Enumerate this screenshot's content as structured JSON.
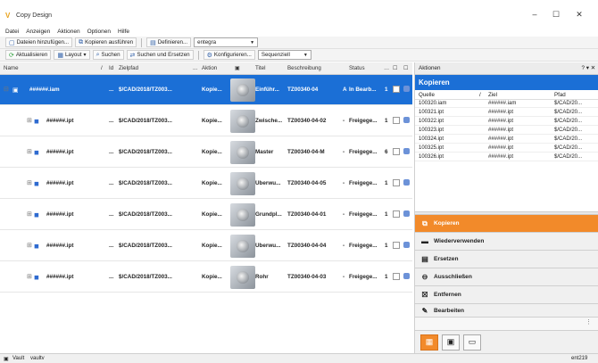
{
  "window": {
    "title": "Copy Design",
    "app_icon": "V"
  },
  "menu": [
    "Datei",
    "Anzeigen",
    "Aktionen",
    "Optionen",
    "Hilfe"
  ],
  "toolbar1": {
    "add_files": "Dateien hinzufügen...",
    "run_copy": "Kopieren ausführen",
    "define": "Definieren...",
    "combo_value": "entegra"
  },
  "toolbar2": {
    "refresh": "Aktualisieren",
    "layout": "Layout",
    "search": "Suchen",
    "search_replace": "Suchen und Ersetzen",
    "configure": "Konfigurieren...",
    "mode": "Sequenziell"
  },
  "grid": {
    "headers": {
      "name": "Name",
      "slash": "/",
      "id": "Id",
      "target": "Zielpfad",
      "ellipsis": "...",
      "action": "Aktion",
      "title": "Titel",
      "desc": "Beschreibung",
      "status": "Status"
    },
    "rows": [
      {
        "name": "######.iam",
        "dots": "...",
        "path": "$/CAD/2018/TZ003...",
        "action": "Kopie...",
        "title": "Einführ...",
        "desc": "TZ00340-04",
        "flag": "A",
        "status": "In Bearb...",
        "count": "1",
        "selected": true
      },
      {
        "name": "######.ipt",
        "dots": "...",
        "path": "$/CAD/2018/TZ003...",
        "action": "Kopie...",
        "title": "Zwische...",
        "desc": "TZ00340-04-02",
        "flag": "-",
        "status": "Freigege...",
        "count": "1"
      },
      {
        "name": "######.ipt",
        "dots": "...",
        "path": "$/CAD/2018/TZ003...",
        "action": "Kopie...",
        "title": "Master",
        "desc": "TZ00340-04-M",
        "flag": "-",
        "status": "Freigege...",
        "count": "6"
      },
      {
        "name": "######.ipt",
        "dots": "...",
        "path": "$/CAD/2018/TZ003...",
        "action": "Kopie...",
        "title": "Überwu...",
        "desc": "TZ00340-04-05",
        "flag": "-",
        "status": "Freigege...",
        "count": "1"
      },
      {
        "name": "######.ipt",
        "dots": "...",
        "path": "$/CAD/2018/TZ003...",
        "action": "Kopie...",
        "title": "Grundpl...",
        "desc": "TZ00340-04-01",
        "flag": "-",
        "status": "Freigege...",
        "count": "1"
      },
      {
        "name": "######.ipt",
        "dots": "...",
        "path": "$/CAD/2018/TZ003...",
        "action": "Kopie...",
        "title": "Überwu...",
        "desc": "TZ00340-04-04",
        "flag": "-",
        "status": "Freigege...",
        "count": "1"
      },
      {
        "name": "######.ipt",
        "dots": "...",
        "path": "$/CAD/2018/TZ003...",
        "action": "Kopie...",
        "title": "Rohr",
        "desc": "TZ00340-04-03",
        "flag": "-",
        "status": "Freigege...",
        "count": "1"
      }
    ]
  },
  "actions_panel": {
    "header": "Aktionen",
    "controls": "? ▾ ✕",
    "title": "Kopieren",
    "columns": {
      "source": "Quelle",
      "slash": "/",
      "target": "Ziel",
      "path": "Pfad"
    },
    "rows": [
      {
        "source": "100320.iam",
        "target": "######.iam",
        "path": "$/CAD/20..."
      },
      {
        "source": "100321.ipt",
        "target": "######.ipt",
        "path": "$/CAD/20..."
      },
      {
        "source": "100322.ipt",
        "target": "######.ipt",
        "path": "$/CAD/20..."
      },
      {
        "source": "100323.ipt",
        "target": "######.ipt",
        "path": "$/CAD/20..."
      },
      {
        "source": "100324.ipt",
        "target": "######.ipt",
        "path": "$/CAD/20..."
      },
      {
        "source": "100325.ipt",
        "target": "######.ipt",
        "path": "$/CAD/20..."
      },
      {
        "source": "100326.ipt",
        "target": "######.ipt",
        "path": "$/CAD/20..."
      }
    ],
    "buttons": [
      "Kopieren",
      "Wiederverwenden",
      "Ersetzen",
      "Ausschließen",
      "Entfernen",
      "Bearbeiten"
    ]
  },
  "statusbar": {
    "vault_label": "Vault",
    "vault_value": "vaultv",
    "right": "ent219"
  },
  "colors": {
    "selection": "#1b6fd6",
    "accent_orange": "#f28a2a"
  }
}
